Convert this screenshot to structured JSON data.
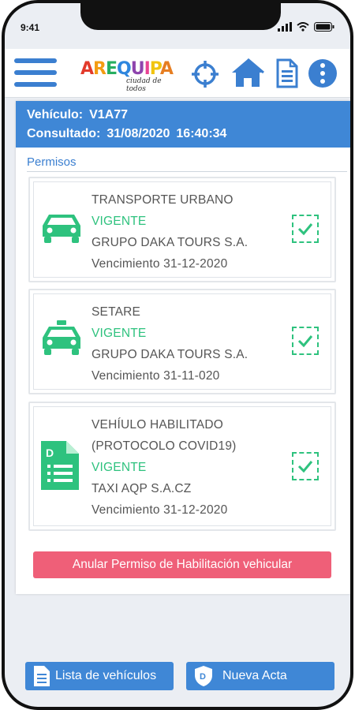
{
  "status_bar": {
    "time": "9:41"
  },
  "header": {
    "logo_title": "AREQUIPA",
    "logo_subtitle": "ciudad de todos",
    "icons": [
      "menu-icon",
      "target-icon",
      "home-icon",
      "document-icon",
      "more-icon"
    ]
  },
  "vehicle": {
    "vehicle_label": "Vehículo:",
    "vehicle_id": "V1A77",
    "consulted_label": "Consultado:",
    "consulted_date": "31/08/2020",
    "consulted_time": "16:40:34"
  },
  "section_title": "Permisos",
  "permits": [
    {
      "icon": "car-icon",
      "title": "TRANSPORTE URBANO",
      "status": "VIGENTE",
      "company": "GRUPO DAKA TOURS S.A.",
      "expiry": "Vencimiento 31-12-2020"
    },
    {
      "icon": "taxi-icon",
      "title": "SETARE",
      "status": "VIGENTE",
      "company": "GRUPO DAKA TOURS S.A.",
      "expiry": "Vencimiento 31-11-020"
    },
    {
      "icon": "document-icon",
      "title": "VEHÍULO HABILITADO",
      "title2": "(PROTOCOLO COVID19)",
      "status": "VIGENTE",
      "company": "TAXI AQP S.A.CZ",
      "expiry": "Vencimiento 31-12-2020"
    }
  ],
  "actions": {
    "annul_label": "Anular Permiso de Habilitación vehicular",
    "vehicles_list_label": "Lista de vehículos",
    "new_act_label": "Nueva Acta"
  },
  "colors": {
    "primary": "#3f87d6",
    "success": "#2ec27e",
    "danger": "#ef5f78"
  }
}
